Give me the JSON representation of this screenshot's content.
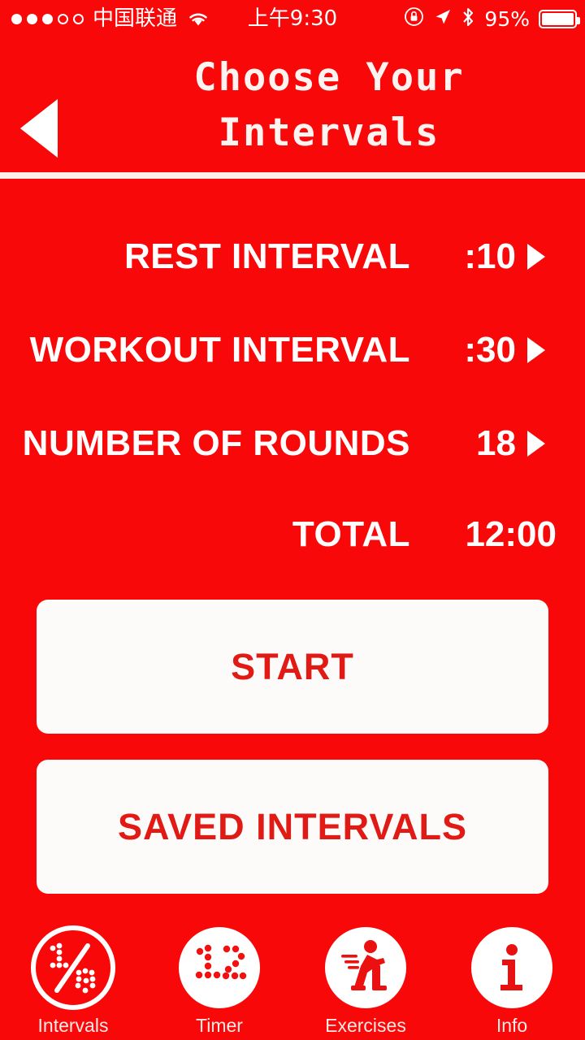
{
  "theme": {
    "background_red": "#f80808",
    "white": "#ffffff",
    "button_text_red": "#e01b15"
  },
  "status_bar": {
    "signal_dots_filled": 3,
    "signal_dots_empty": 2,
    "carrier": "中国联通",
    "wifi_icon": "wifi-icon",
    "time": "上午9:30",
    "rotation_lock_icon": "rotation-lock-icon",
    "location_icon": "location-arrow-icon",
    "bluetooth_icon": "bluetooth-icon",
    "battery_percent": "95%",
    "battery_icon": "battery-full-icon"
  },
  "header": {
    "back_icon": "back-arrow-icon",
    "title_line1": "Choose Your",
    "title_line2": "Intervals"
  },
  "settings": {
    "rows": [
      {
        "label": "REST INTERVAL",
        "value": ":10",
        "chevron": "chevron-right-icon",
        "has_chevron": true
      },
      {
        "label": "WORKOUT INTERVAL",
        "value": ":30",
        "chevron": "chevron-right-icon",
        "has_chevron": true
      },
      {
        "label": "NUMBER OF ROUNDS",
        "value": "18",
        "chevron": "chevron-right-icon",
        "has_chevron": true
      },
      {
        "label": "TOTAL",
        "value": "12:00",
        "chevron": "",
        "has_chevron": false
      }
    ]
  },
  "actions": {
    "start_label": "START",
    "saved_label": "SAVED INTERVALS"
  },
  "tabbar": {
    "items": [
      {
        "label": "Intervals",
        "icon": "intervals-fraction-icon",
        "selected": true
      },
      {
        "label": "Timer",
        "icon": "timer-12-icon",
        "selected": false
      },
      {
        "label": "Exercises",
        "icon": "running-figure-icon",
        "selected": false
      },
      {
        "label": "Info",
        "icon": "info-i-icon",
        "selected": false
      }
    ]
  }
}
